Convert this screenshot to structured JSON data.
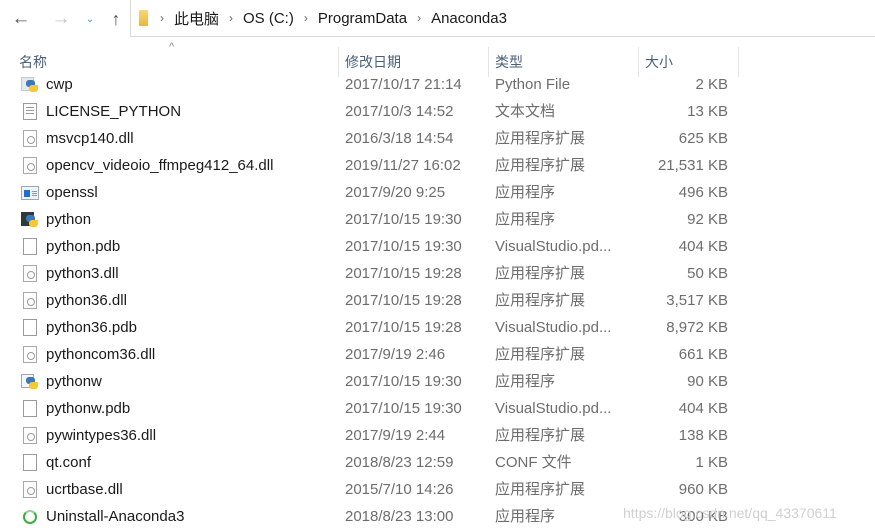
{
  "nav": {
    "back_icon": "←",
    "forward_icon": "→",
    "recent_icon": "⌄",
    "up_icon": "↑"
  },
  "breadcrumb": {
    "separator": "›",
    "items": [
      "此电脑",
      "OS (C:)",
      "ProgramData",
      "Anaconda3"
    ]
  },
  "columns": {
    "name": "名称",
    "date": "修改日期",
    "type": "类型",
    "size": "大小",
    "sort_indicator": "^"
  },
  "files": [
    {
      "icon": "python-file-icon",
      "name": "cwp",
      "date": "2017/10/17 21:14",
      "type": "Python File",
      "size": "2 KB"
    },
    {
      "icon": "text-document-icon",
      "name": "LICENSE_PYTHON",
      "date": "2017/10/3 14:52",
      "type": "文本文档",
      "size": "13 KB"
    },
    {
      "icon": "dll-icon",
      "name": "msvcp140.dll",
      "date": "2016/3/18 14:54",
      "type": "应用程序扩展",
      "size": "625 KB"
    },
    {
      "icon": "dll-icon",
      "name": "opencv_videoio_ffmpeg412_64.dll",
      "date": "2019/11/27 16:02",
      "type": "应用程序扩展",
      "size": "21,531 KB"
    },
    {
      "icon": "application-icon",
      "name": "openssl",
      "date": "2017/9/20 9:25",
      "type": "应用程序",
      "size": "496 KB"
    },
    {
      "icon": "python-console-icon",
      "name": "python",
      "date": "2017/10/15 19:30",
      "type": "应用程序",
      "size": "92 KB"
    },
    {
      "icon": "blank-file-icon",
      "name": "python.pdb",
      "date": "2017/10/15 19:30",
      "type": "VisualStudio.pd...",
      "size": "404 KB"
    },
    {
      "icon": "dll-icon",
      "name": "python3.dll",
      "date": "2017/10/15 19:28",
      "type": "应用程序扩展",
      "size": "50 KB"
    },
    {
      "icon": "dll-icon",
      "name": "python36.dll",
      "date": "2017/10/15 19:28",
      "type": "应用程序扩展",
      "size": "3,517 KB"
    },
    {
      "icon": "blank-file-icon",
      "name": "python36.pdb",
      "date": "2017/10/15 19:28",
      "type": "VisualStudio.pd...",
      "size": "8,972 KB"
    },
    {
      "icon": "dll-icon",
      "name": "pythoncom36.dll",
      "date": "2017/9/19 2:46",
      "type": "应用程序扩展",
      "size": "661 KB"
    },
    {
      "icon": "python-window-icon",
      "name": "pythonw",
      "date": "2017/10/15 19:30",
      "type": "应用程序",
      "size": "90 KB"
    },
    {
      "icon": "blank-file-icon",
      "name": "pythonw.pdb",
      "date": "2017/10/15 19:30",
      "type": "VisualStudio.pd...",
      "size": "404 KB"
    },
    {
      "icon": "dll-icon",
      "name": "pywintypes36.dll",
      "date": "2017/9/19 2:44",
      "type": "应用程序扩展",
      "size": "138 KB"
    },
    {
      "icon": "blank-file-icon",
      "name": "qt.conf",
      "date": "2018/8/23 12:59",
      "type": "CONF 文件",
      "size": "1 KB"
    },
    {
      "icon": "dll-icon",
      "name": "ucrtbase.dll",
      "date": "2015/7/10 14:26",
      "type": "应用程序扩展",
      "size": "960 KB"
    },
    {
      "icon": "uninstall-icon",
      "name": "Uninstall-Anaconda3",
      "date": "2018/8/23 13:00",
      "type": "应用程序",
      "size": "300 KB"
    }
  ],
  "watermark": "https://blog.csdn.net/qq_43370611"
}
